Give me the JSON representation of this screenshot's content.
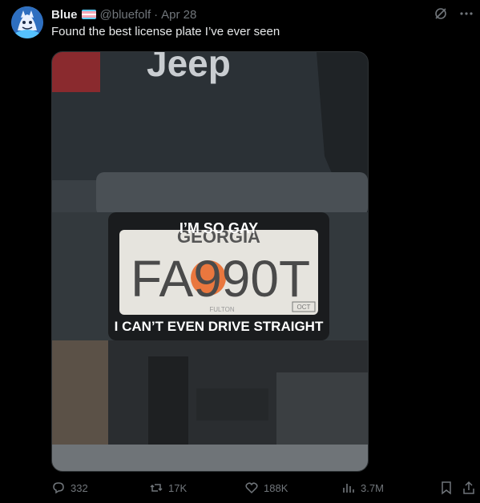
{
  "tweet": {
    "author_name": "Blue",
    "handle": "@bluefolf",
    "separator": "·",
    "date": "Apr 28",
    "text": "Found the best license plate I’ve ever seen"
  },
  "media": {
    "car_logo": "Jeep",
    "frame_top": "I’M SO GAY",
    "plate_state": "GEORGIA",
    "plate_number": "FA990T",
    "frame_bottom": "I CAN’T EVEN DRIVE STRAIGHT",
    "plate_county": "FULTON",
    "plate_sticker": "OCT"
  },
  "actions": {
    "replies": "332",
    "reposts": "17K",
    "likes": "188K",
    "views": "3.7M"
  },
  "colors": {
    "background": "#000000",
    "text_primary": "#e7e9ea",
    "text_secondary": "#71767b",
    "trans_flag": [
      "#5BCEFA",
      "#F5A9B8",
      "#FFFFFF",
      "#F5A9B8",
      "#5BCEFA"
    ]
  },
  "icons": {
    "top": [
      "grok-icon",
      "more-icon"
    ],
    "actions": [
      "reply-icon",
      "repost-icon",
      "like-icon",
      "views-icon",
      "bookmark-icon",
      "share-icon"
    ]
  }
}
